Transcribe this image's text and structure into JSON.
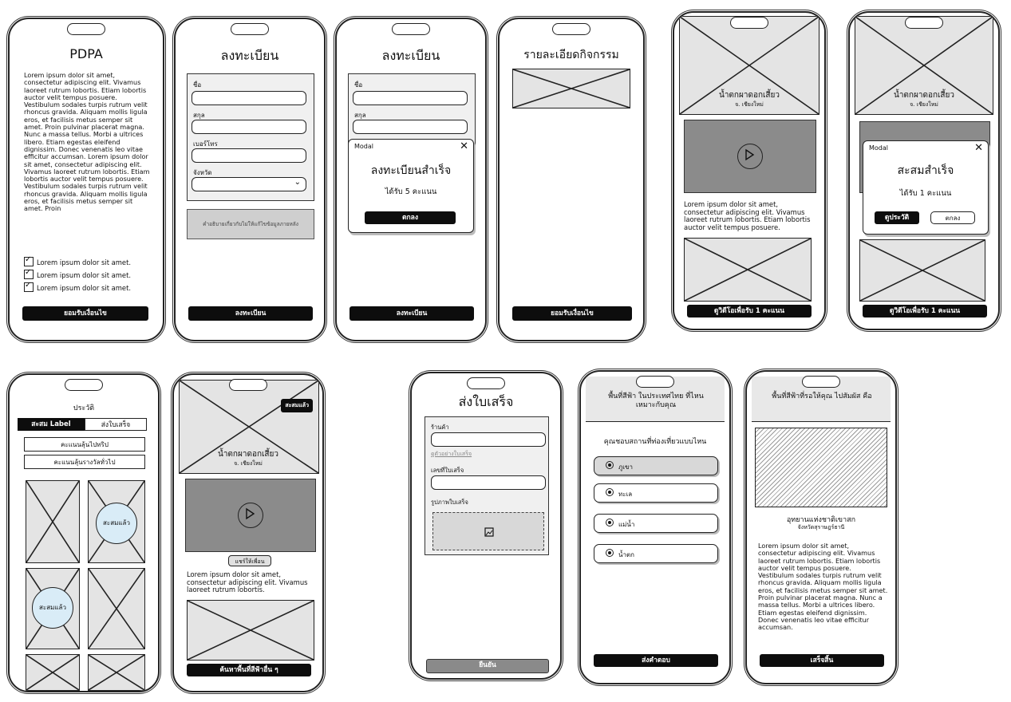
{
  "screens": {
    "pdpa": {
      "title": "PDPA",
      "body": "Lorem ipsum dolor sit amet, consectetur adipiscing elit. Vivamus laoreet rutrum lobortis. Etiam lobortis auctor velit tempus posuere. Vestibulum sodales turpis rutrum velit rhoncus gravida. Aliquam mollis ligula eros, et facilisis metus semper sit amet. Proin pulvinar placerat magna. Nunc a massa tellus. Morbi a ultrices libero. Etiam egestas eleifend dignissim. Donec venenatis leo vitae efficitur accumsan. Lorem ipsum dolor sit amet, consectetur adipiscing elit. Vivamus laoreet rutrum lobortis. Etiam lobortis auctor velit tempus posuere. Vestibulum sodales turpis rutrum velit rhoncus gravida. Aliquam mollis ligula eros, et facilisis metus semper sit amet. Proin",
      "checks": [
        "Lorem ipsum dolor sit amet.",
        "Lorem ipsum dolor sit amet.",
        "Lorem ipsum dolor sit amet."
      ],
      "button": "ยอมรับเงื่อนไข"
    },
    "register1": {
      "title": "ลงทะเบียน",
      "fields": [
        "ชื่อ",
        "สกุล",
        "เบอร์โทร",
        "จังหวัด"
      ],
      "note": "คำอธิบายเกี่ยวกับไม่ให้แก้ไขข้อมูลภายหลัง",
      "button": "ลงทะเบียน"
    },
    "register2": {
      "title": "ลงทะเบียน",
      "fields": [
        "ชื่อ",
        "สกุล"
      ],
      "modal_label": "Modal",
      "modal_close": "✕",
      "modal_title": "ลงทะเบียนสำเร็จ",
      "modal_sub": "ได้รับ 5 คะแนน",
      "modal_button": "ตกลง",
      "button": "ลงทะเบียน"
    },
    "activity": {
      "title": "รายละเอียดกิจกรรม",
      "button": "ยอมรับเงื่อนไข"
    },
    "waterfall": {
      "place": "น้ำตกผาดอกเสี้ยว",
      "province": "จ. เชียงใหม่",
      "body": "Lorem ipsum dolor sit amet, consectetur adipiscing elit. Vivamus laoreet rutrum lobortis. Etiam lobortis auctor velit tempus posuere.",
      "button": "ดูวิดีโอเพื่อรับ 1 คะแนน"
    },
    "collect": {
      "place": "น้ำตกผาดอกเสี้ยว",
      "province": "จ. เชียงใหม่",
      "modal_label": "Modal",
      "modal_close": "✕",
      "modal_title": "สะสมสำเร็จ",
      "modal_sub": "ได้รับ 1 คะแนน",
      "modal_history": "ดูประวัติ",
      "modal_ok": "ตกลง",
      "button": "ดูวิดีโอเพื่อรับ 1 คะแนน"
    },
    "history": {
      "title": "ประวัติ",
      "tab_active": "สะสม Label",
      "tab_inactive": "ส่งใบเสร็จ",
      "row1": "คะแนนลุ้นไปทริป",
      "row2": "คะแนนลุ้นรางวัลทั่วไป",
      "badge1": "สะสมแล้ว",
      "badge2": "สะสมแล้ว"
    },
    "detail2": {
      "corner_badge": "สะสมแล้ว",
      "place": "น้ำตกผาดอกเสี้ยว",
      "province": "จ. เชียงใหม่",
      "share": "แชร์ให้เพื่อน",
      "body": "Lorem ipsum dolor sit amet, consectetur adipiscing elit. Vivamus laoreet rutrum lobortis.",
      "button": "ค้นหาพื้นที่สีฟ้าอื่น ๆ"
    },
    "receipt": {
      "title": "ส่งใบเสร็จ",
      "shop_label": "ร้านค้า",
      "example_link": "ดูตัวอย่างใบเสร็จ",
      "receipt_no": "เลขที่ใบเสร็จ",
      "photo_label": "รูปภาพใบเสร็จ",
      "button": "ยืนยัน"
    },
    "quiz": {
      "title": "พื้นที่สีฟ้า ในประเทศไทย ที่ไหนเหมาะกับคุณ",
      "question": "คุณชอบสถานที่ท่องเที่ยวแบบไหน",
      "options": [
        "ภูเขา",
        "ทะเล",
        "แม่น้ำ",
        "น้ำตก"
      ],
      "button": "ส่งคำตอบ"
    },
    "result": {
      "title": "พื้นที่สีฟ้าที่รอให้คุณ ไปสัมผัส คือ",
      "place": "อุทยานแห่งชาติเขาสก",
      "province": "จังหวัดสุราษฎร์ธานี",
      "body": "Lorem ipsum dolor sit amet, consectetur adipiscing elit. Vivamus laoreet rutrum lobortis. Etiam lobortis auctor velit tempus posuere. Vestibulum sodales turpis rutrum velit rhoncus gravida. Aliquam mollis ligula eros, et facilisis metus semper sit amet. Proin pulvinar placerat magna. Nunc a massa tellus. Morbi a ultrices libero. Etiam egestas eleifend dignissim. Donec venenatis leo vitae efficitur accumsan.",
      "button": "เสร็จสิ้น"
    }
  }
}
